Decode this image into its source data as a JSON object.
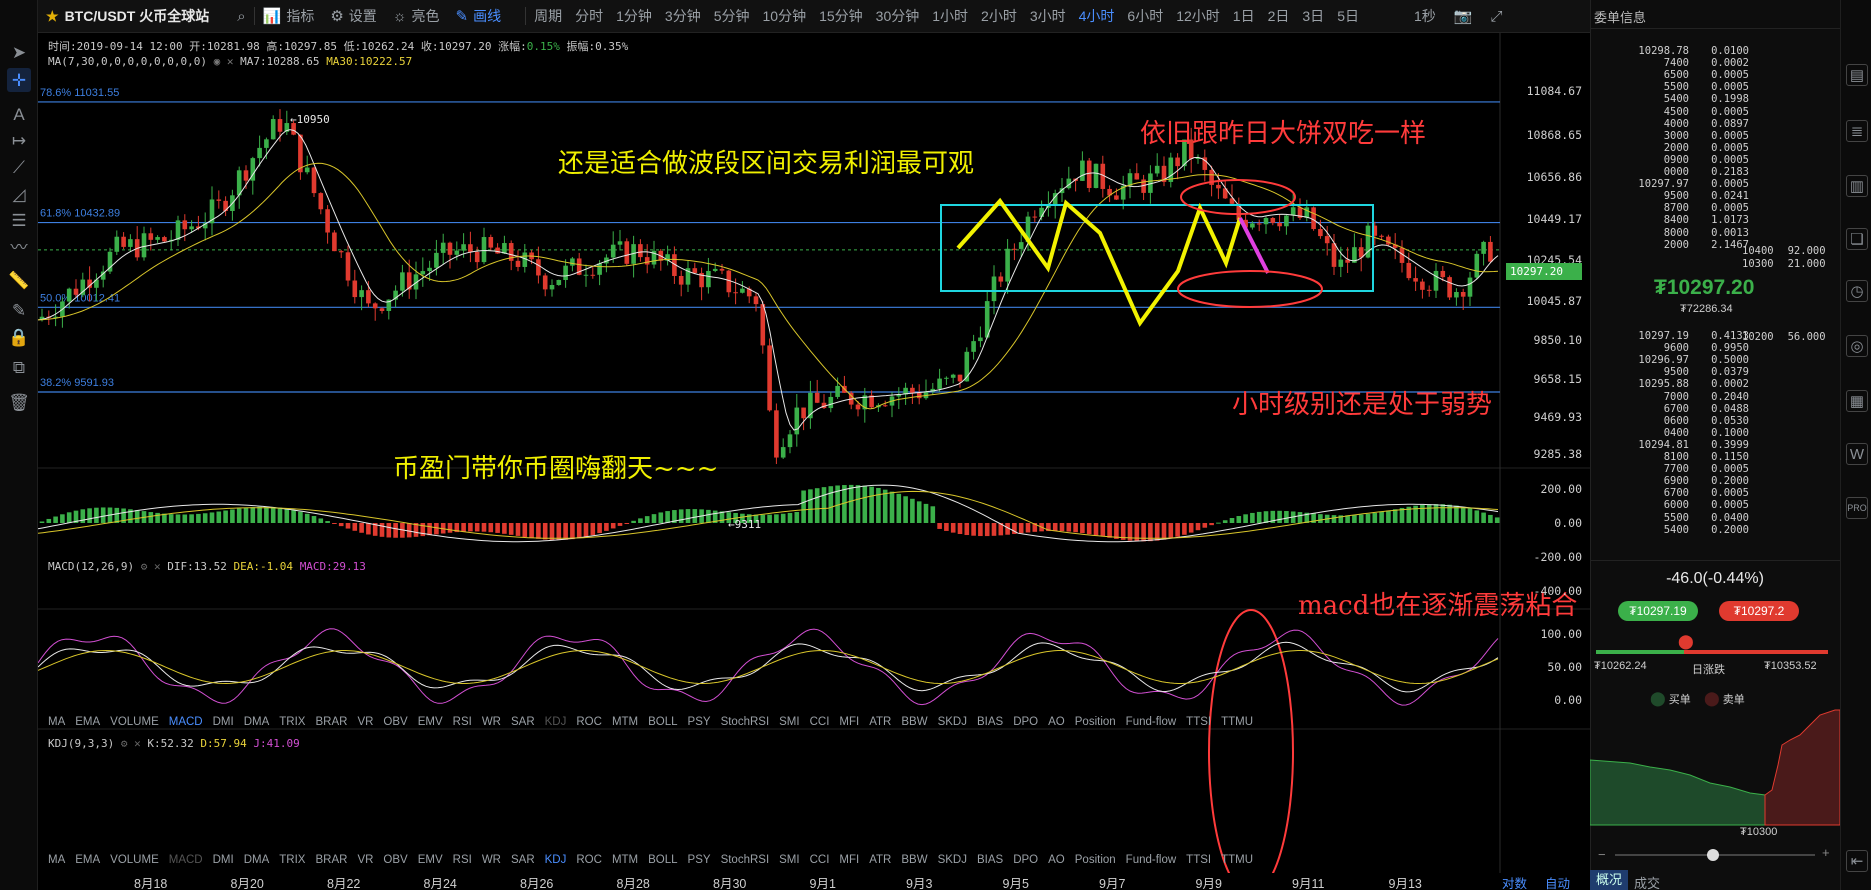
{
  "symbol": "BTC/USDT 火币全球站",
  "toolbar": {
    "indicators": "指标",
    "settings": "设置",
    "brightness": "亮色",
    "draw": "画线",
    "period_label": "周期",
    "periods": [
      "分时",
      "1分钟",
      "3分钟",
      "5分钟",
      "10分钟",
      "15分钟",
      "30分钟",
      "1小时",
      "2小时",
      "3小时",
      "4小时",
      "6小时",
      "12小时",
      "1日",
      "2日",
      "3日",
      "5日"
    ],
    "active_period": "4小时",
    "refresh": "1秒"
  },
  "ohlc_line": "时间:2019-09-14 12:00  开:10281.98  高:10297.85  低:10262.24  收:10297.20  涨幅:",
  "ohlc_change": "0.15%",
  "ohlc_amp": "  振幅:0.35%",
  "ma_line": {
    "label": "MA(7,30,0,0,0,0,0,0,0,0)",
    "ma7": "MA7:10288.65",
    "ma30": "MA30:10222.57"
  },
  "fib_levels": [
    {
      "label": "78.6% 11031.55",
      "price": 11031.55
    },
    {
      "label": "61.8% 10432.89",
      "price": 10432.89
    },
    {
      "label": "50.0% 10012.41",
      "price": 10012.41
    },
    {
      "label": "38.2% 9591.93",
      "price": 9591.93
    }
  ],
  "price_axis": [
    "11084.67",
    "10868.65",
    "10656.86",
    "10449.17",
    "10245.54",
    "10045.87",
    "9850.10",
    "9658.15",
    "9469.93",
    "9285.38"
  ],
  "current_price_tag": "10297.20",
  "hi_label": "←10950",
  "lo_label": "←9311",
  "annotations": {
    "a1": "还是适合做波段区间交易利润最可观",
    "a2": "依旧跟昨日大饼双吃一样",
    "a3": "小时级别还是处于弱势",
    "a4": "币盈门带你币圈嗨翻天~~~",
    "a5": "macd也在逐渐震荡粘合"
  },
  "macd": {
    "label": "MACD(12,26,9)",
    "dif": "DIF:13.52",
    "dea": "DEA:-1.04",
    "macd": "MACD:29.13",
    "axis": [
      "200.00",
      "0.00",
      "-200.00",
      "-400.00"
    ]
  },
  "indicator_tabs": [
    "MA",
    "EMA",
    "VOLUME",
    "MACD",
    "DMI",
    "DMA",
    "TRIX",
    "BRAR",
    "VR",
    "OBV",
    "EMV",
    "RSI",
    "WR",
    "SAR",
    "KDJ",
    "ROC",
    "MTM",
    "BOLL",
    "PSY",
    "StochRSI",
    "SMI",
    "CCI",
    "MFI",
    "ATR",
    "BBW",
    "SKDJ",
    "BIAS",
    "DPO",
    "AO",
    "Position",
    "Fund-flow",
    "TTSI",
    "TTMU"
  ],
  "kdj": {
    "label": "KDJ(9,3,3)",
    "k": "K:52.32",
    "d": "D:57.94",
    "j": "J:41.09",
    "axis": [
      "100.00",
      "50.00",
      "0.00"
    ]
  },
  "x_axis": [
    "8月18",
    "8月20",
    "8月22",
    "8月24",
    "8月26",
    "8月28",
    "8月30",
    "9月1",
    "9月3",
    "9月5",
    "9月7",
    "9月9",
    "9月11",
    "9月13"
  ],
  "bottom_tabs": {
    "log": "对数",
    "auto": "自动",
    "overview": "概况",
    "trades": "成交"
  },
  "orderbook": {
    "title": "委单信息",
    "asks": [
      [
        "10298.78",
        "0.0100"
      ],
      [
        "7400",
        "0.0002"
      ],
      [
        "6500",
        "0.0005"
      ],
      [
        "5500",
        "0.0005"
      ],
      [
        "5400",
        "0.1998"
      ],
      [
        "4500",
        "0.0005"
      ],
      [
        "4000",
        "0.0897"
      ],
      [
        "3000",
        "0.0005"
      ],
      [
        "2000",
        "0.0005"
      ],
      [
        "0900",
        "0.0005"
      ],
      [
        "0000",
        "0.2183"
      ],
      [
        "10297.97",
        "0.0005"
      ],
      [
        "9500",
        "0.0241"
      ],
      [
        "8700",
        "0.0005"
      ],
      [
        "8400",
        "1.0173"
      ],
      [
        "8000",
        "0.0013"
      ],
      [
        "2000",
        "2.1467"
      ]
    ],
    "ask_extra": [
      [
        "10400",
        "92.000"
      ],
      [
        "10300",
        "21.000"
      ]
    ],
    "last_price": "₮10297.20",
    "last_price_sub": "₮72286.34",
    "bids": [
      [
        "10297.19",
        "0.4133"
      ],
      [
        "9600",
        "0.9950"
      ],
      [
        "10296.97",
        "0.5000"
      ],
      [
        "9500",
        "0.0379"
      ],
      [
        "10295.88",
        "0.0002"
      ],
      [
        "7000",
        "0.2040"
      ],
      [
        "6700",
        "0.0488"
      ],
      [
        "0600",
        "0.0530"
      ],
      [
        "0400",
        "0.1000"
      ],
      [
        "10294.81",
        "0.3999"
      ],
      [
        "8100",
        "0.1150"
      ],
      [
        "7700",
        "0.0005"
      ],
      [
        "6900",
        "0.2000"
      ],
      [
        "6700",
        "0.0005"
      ],
      [
        "6000",
        "0.0005"
      ],
      [
        "5500",
        "0.0400"
      ],
      [
        "5400",
        "0.2000"
      ]
    ],
    "bid_extra": [
      [
        "10200",
        "56.000"
      ]
    ]
  },
  "summary": {
    "change": "-46.0(-0.44%)",
    "bid_btn": "₮10297.19",
    "ask_btn": "₮10297.2",
    "low": "₮10262.24",
    "range_label": "日涨跌",
    "high": "₮10353.52",
    "legend_buy": "买单",
    "legend_sell": "卖单",
    "depth_label": "₮10300"
  },
  "colors": {
    "up": "#3bb04a",
    "down": "#e03a2f",
    "accent": "#4a8eff",
    "annotation_yellow": "#f0f000",
    "annotation_red": "#ff3b3b"
  }
}
